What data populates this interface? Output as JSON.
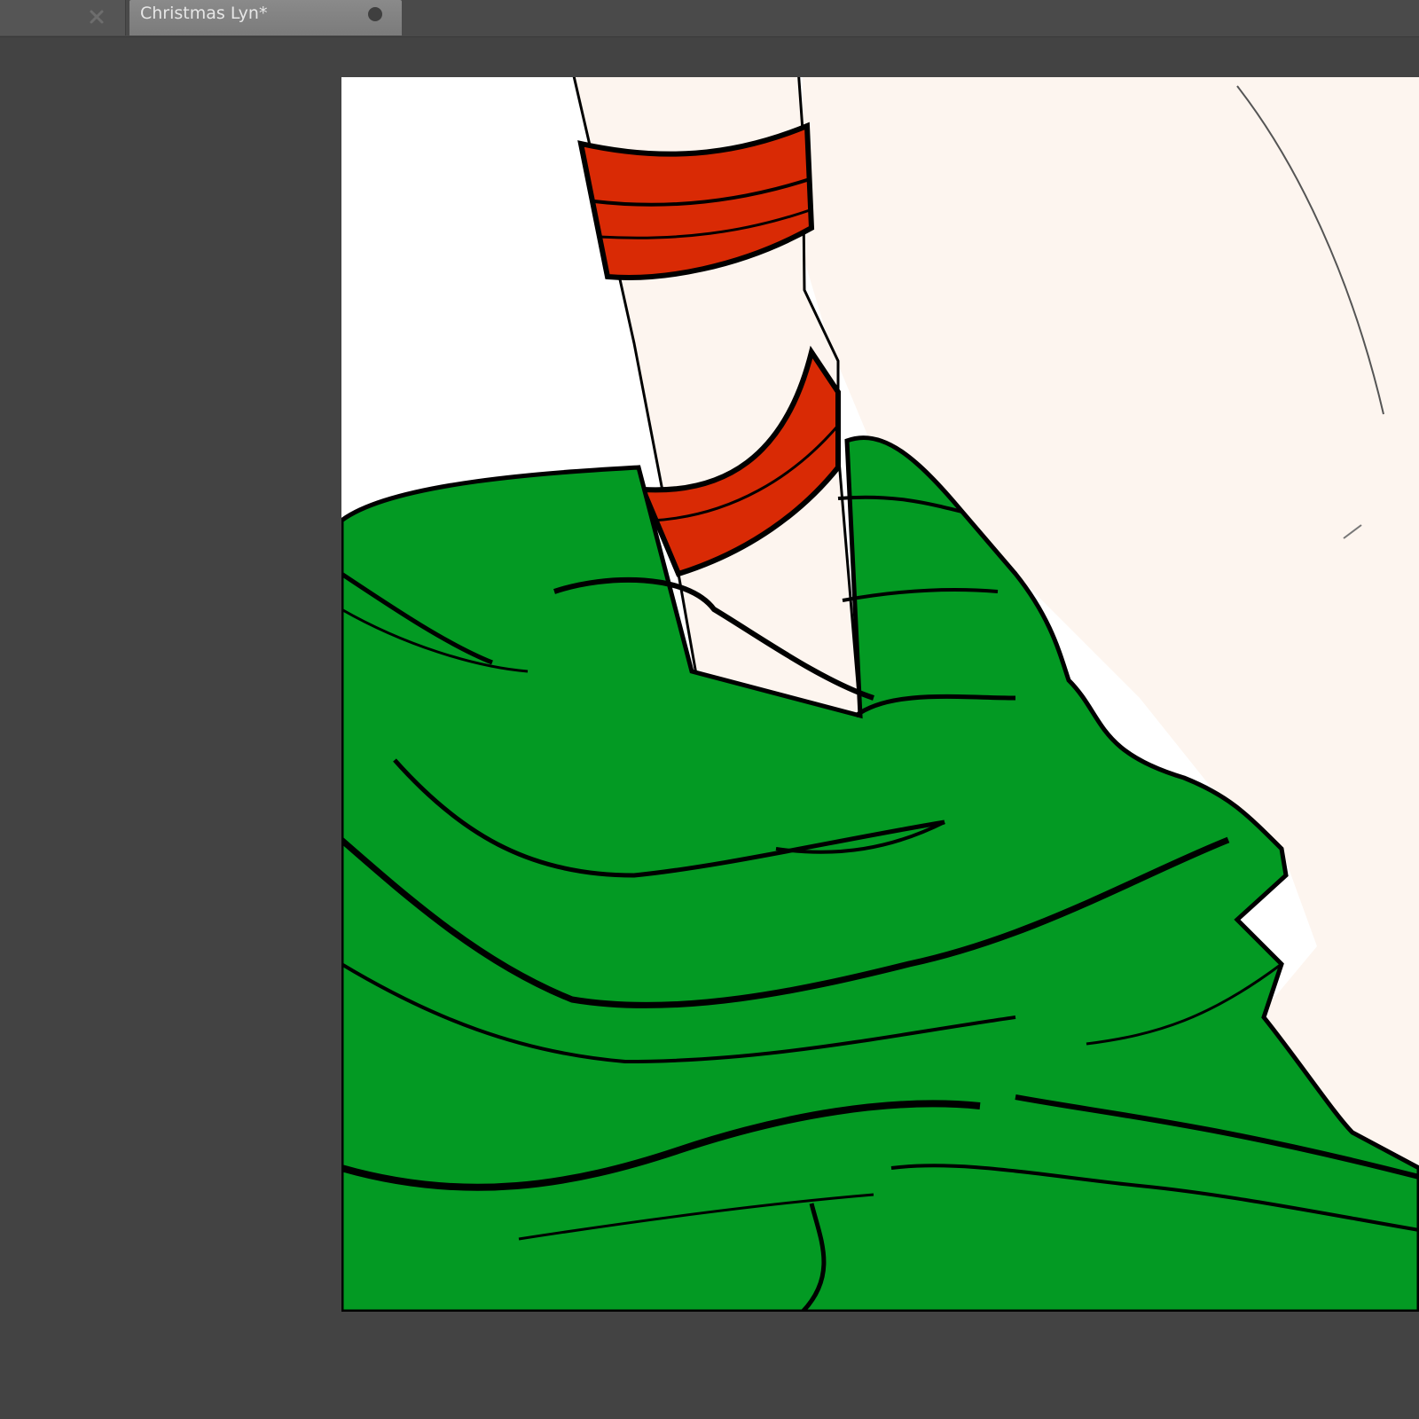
{
  "document_tabs": {
    "inactive_tab": {
      "close_icon": "close-x-icon"
    },
    "active_tab": {
      "title": "Christmas Lyn*",
      "modified_icon": "unsaved-dot-icon"
    }
  },
  "canvas": {
    "description_colors": {
      "background": "#ffffff",
      "skin": "#fdf5ef",
      "sweater": "#039a23",
      "bands": "#d92a05",
      "lineart": "#000000"
    }
  }
}
